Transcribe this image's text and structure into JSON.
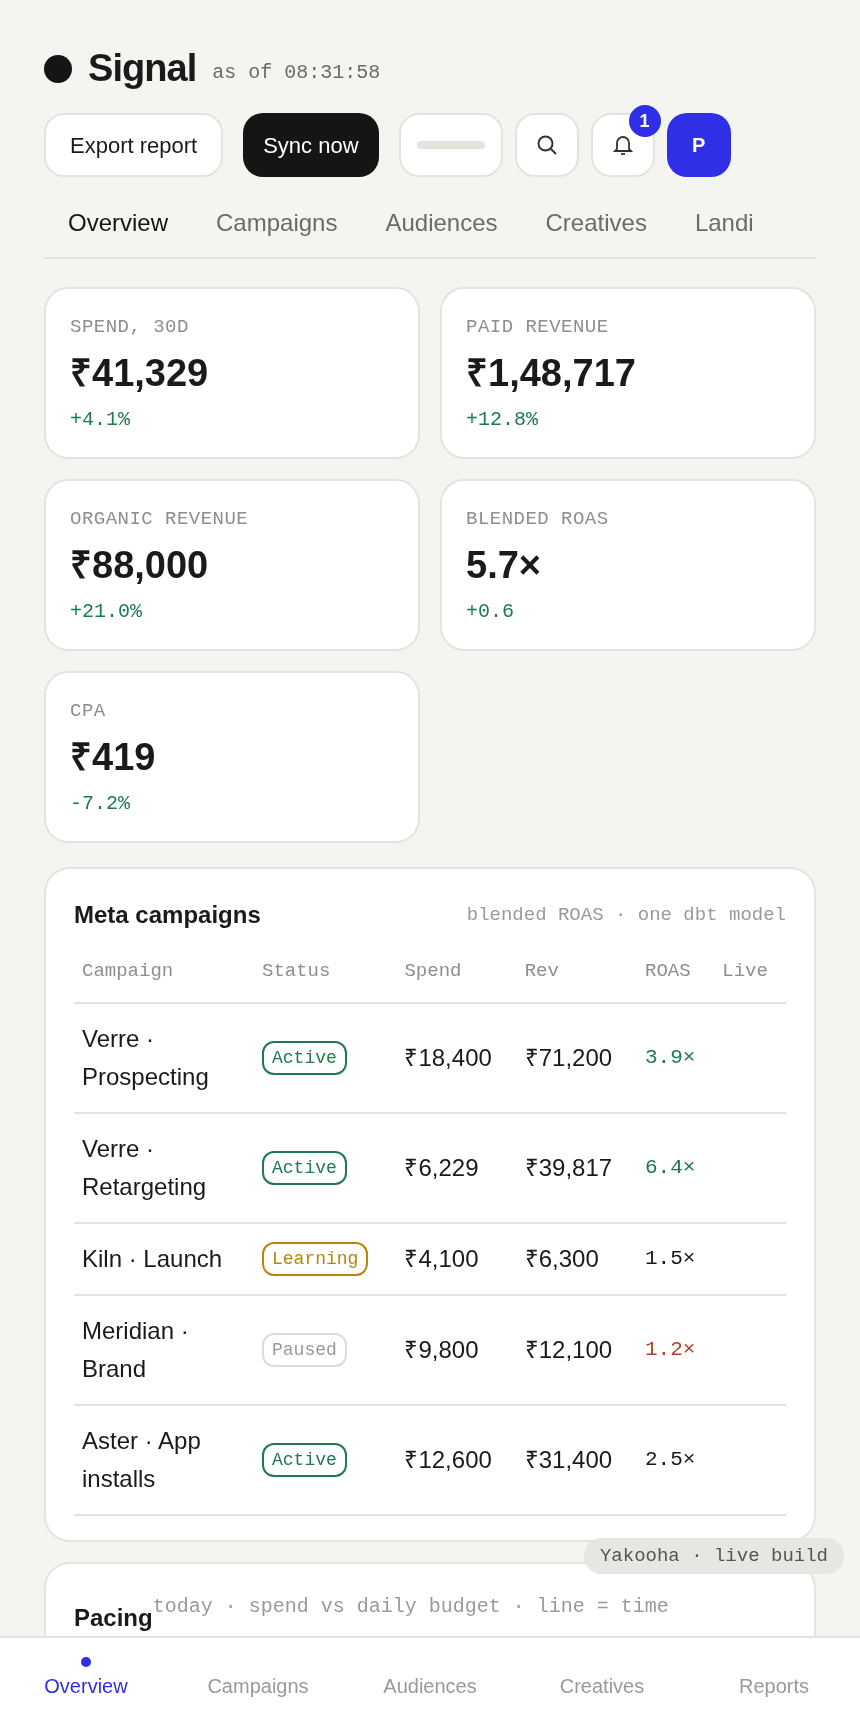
{
  "header": {
    "title": "Signal",
    "timestamp": "as of 08:31:58"
  },
  "actions": {
    "export": "Export report",
    "sync": "Sync now",
    "notifications": "1",
    "avatar": "P"
  },
  "tabs": [
    {
      "label": "Overview",
      "selected": true
    },
    {
      "label": "Campaigns",
      "selected": false
    },
    {
      "label": "Audiences",
      "selected": false
    },
    {
      "label": "Creatives",
      "selected": false
    },
    {
      "label": "Landi",
      "selected": false
    }
  ],
  "kpis": [
    {
      "label": "SPEND, 30D",
      "value": "₹41,329",
      "delta": "+4.1%",
      "color": "#1f7a4d"
    },
    {
      "label": "PAID REVENUE",
      "value": "₹1,48,717",
      "delta": "+12.8%",
      "color": "#1f7a4d"
    },
    {
      "label": "ORGANIC REVENUE",
      "value": "₹88,000",
      "delta": "+21.0%",
      "color": "#1f7a4d"
    },
    {
      "label": "BLENDED ROAS",
      "value": "5.7×",
      "delta": "+0.6",
      "color": "#1f7a4d"
    },
    {
      "label": "CPA",
      "value": "₹419",
      "delta": "-7.2%",
      "color": "#1f7a4d"
    }
  ],
  "campaigns": {
    "title": "Meta campaigns",
    "subtitle": "blended ROAS · one dbt model",
    "columns": [
      "Campaign",
      "Status",
      "Spend",
      "Rev",
      "ROAS",
      "Live"
    ],
    "rows": [
      {
        "name": "Verre · Prospecting",
        "status": "Active",
        "kind": "active",
        "spend": "₹18,400",
        "rev": "₹71,200",
        "roas": "3.9×",
        "color": "#1f7a4d"
      },
      {
        "name": "Verre · Retargeting",
        "status": "Active",
        "kind": "active",
        "spend": "₹6,229",
        "rev": "₹39,817",
        "roas": "6.4×",
        "color": "#1f7a4d"
      },
      {
        "name": "Kiln · Launch",
        "status": "Learning",
        "kind": "learning",
        "spend": "₹4,100",
        "rev": "₹6,300",
        "roas": "1.5×",
        "color": "#1a1a1a"
      },
      {
        "name": "Meridian · Brand",
        "status": "Paused",
        "kind": "paused",
        "spend": "₹9,800",
        "rev": "₹12,100",
        "roas": "1.2×",
        "color": "#b5412b"
      },
      {
        "name": "Aster · App installs",
        "status": "Active",
        "kind": "active",
        "spend": "₹12,600",
        "rev": "₹31,400",
        "roas": "2.5×",
        "color": "#1a1a1a"
      }
    ]
  },
  "build_badge": "Yakooha · live build",
  "pacing": {
    "title": "Pacing",
    "subtitle": "today · spend vs daily budget · line = time"
  },
  "bottom_nav": [
    {
      "label": "Overview",
      "selected": true
    },
    {
      "label": "Campaigns",
      "selected": false
    },
    {
      "label": "Audiences",
      "selected": false
    },
    {
      "label": "Creatives",
      "selected": false
    },
    {
      "label": "Reports",
      "selected": false
    }
  ]
}
